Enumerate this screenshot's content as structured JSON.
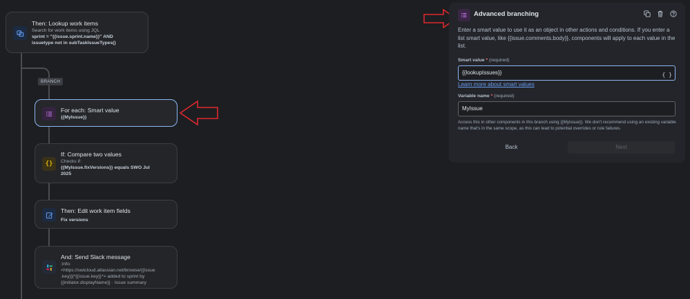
{
  "flow": {
    "branch_tag": "BRANCH",
    "lookup": {
      "title": "Then: Lookup work items",
      "line1": "Search for work items using JQL",
      "line2": "sprint = \"{{issue.sprint.name}}\" AND",
      "line3": "issuetype not in subTaskIssueTypes()"
    },
    "for_each": {
      "title": "For each: Smart value",
      "value": "{{MyIssue}}"
    },
    "if_compare": {
      "title": "If: Compare two values",
      "line1": "Checks if:",
      "line2": "{{MyIssue.fixVersions}} equals SWO Jul",
      "line3": "2025"
    },
    "edit_fields": {
      "title": "Then: Edit work item fields",
      "value": "Fix versions"
    },
    "slack": {
      "title": "And: Send Slack message",
      "line1": ":info:",
      "line2": "<https://swicloud.atlassian.net/browse/{{issue",
      "line3": ".key}}|*{{issue.key}}*> added to sprint by",
      "line4": "{{initiator.displayName}} · Issue summary"
    }
  },
  "panel": {
    "title": "Advanced branching",
    "description": "Enter a smart value to use it as an object in other actions and conditions. If you enter a list smart value, like {{issue.comments.body}}, components will apply to each value in the list.",
    "smart_value_label": "Smart value",
    "smart_value_required_mark": "*",
    "smart_value_required_text": "(required)",
    "smart_value_input": "{{lookupIssues}}",
    "smart_value_button": "{ }",
    "learn_more_link": "Learn more about smart values",
    "variable_name_label": "Variable name",
    "variable_name_required_mark": "*",
    "variable_name_required_text": "(required)",
    "variable_name_input": "MyIssue",
    "helper_text": "Access this in other components in this branch using {{MyIssue}}. We don't recommend using an existing variable name that's in the same scope, as this can lead to potential overrides or rule failures.",
    "back_button": "Back",
    "next_button": "Next"
  },
  "colors": {
    "background": "#1d1e21",
    "card": "#242528",
    "selected_border": "#8fb8f6",
    "link": "#669df1",
    "required": "#f87168",
    "annotation_arrow": "#e0282e"
  }
}
